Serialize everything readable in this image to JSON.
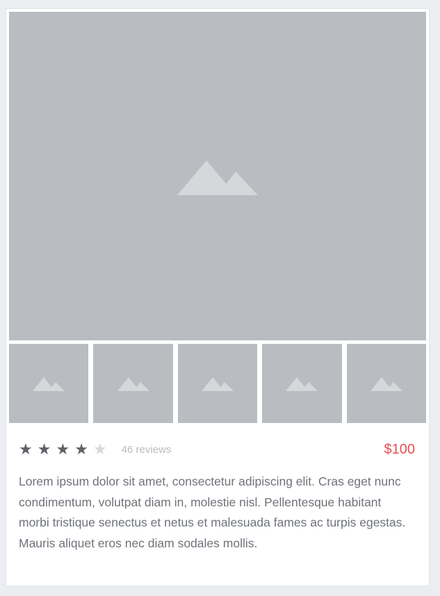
{
  "product": {
    "rating": 4,
    "rating_max": 5,
    "stars": [
      "★",
      "★",
      "★",
      "★",
      "★"
    ],
    "reviews_label": "46 reviews",
    "price": "$100",
    "description": "Lorem ipsum dolor sit amet, consectetur adipiscing elit. Cras eget nunc condimentum, volutpat diam in, molestie nisl. Pellentesque habitant morbi tristique senectus et netus et malesuada fames ac turpis egestas. Mauris aliquet eros nec diam sodales mollis."
  },
  "images": {
    "main_icon": "mountain-icon",
    "thumbnail_icon": "mountain-icon",
    "thumbnail_count": 5
  },
  "colors": {
    "placeholder": "#b9bcc1",
    "placeholder_icon": "#d5d7da",
    "star_filled": "#5e6268",
    "star_empty": "#d6d8dc",
    "price": "#e84e55",
    "text": "#6f737a"
  }
}
